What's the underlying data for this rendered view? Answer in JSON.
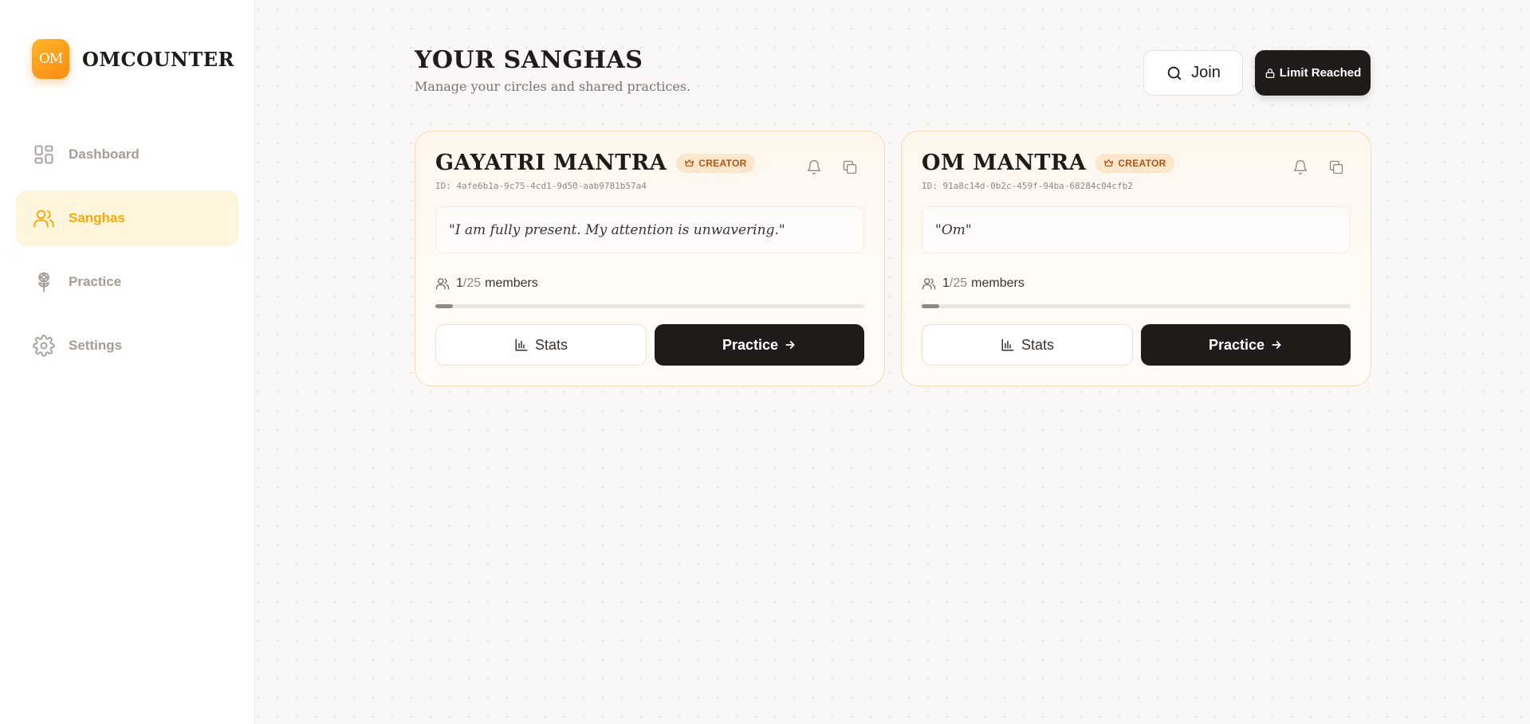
{
  "app": {
    "logo_text": "OM",
    "name": "OMCOUNTER"
  },
  "sidebar": {
    "items": [
      {
        "label": "Dashboard",
        "icon": "dashboard-icon",
        "active": false
      },
      {
        "label": "Sanghas",
        "icon": "users-icon",
        "active": true
      },
      {
        "label": "Practice",
        "icon": "flower-icon",
        "active": false
      },
      {
        "label": "Settings",
        "icon": "gear-icon",
        "active": false
      }
    ]
  },
  "header": {
    "title": "YOUR SANGHAS",
    "subtitle": "Manage your circles and shared practices.",
    "join_label": "Join",
    "limit_label": "Limit Reached"
  },
  "cards": [
    {
      "title": "GAYATRI MANTRA",
      "badge": "CREATOR",
      "id": "ID: 4afe6b1a-9c75-4cd1-9d50-aab9781b57a4",
      "quote": "\"I am fully present. My attention is unwavering.\"",
      "members_count": "1",
      "members_total": "/25",
      "members_label": "members",
      "progress": 0.04,
      "stats_label": "Stats",
      "practice_label": "Practice"
    },
    {
      "title": "OM MANTRA",
      "badge": "CREATOR",
      "id": "ID: 91a8c14d-0b2c-459f-94ba-68284c04cfb2",
      "quote": "\"Om\"",
      "members_count": "1",
      "members_total": "/25",
      "members_label": "members",
      "progress": 0.04,
      "stats_label": "Stats",
      "practice_label": "Practice"
    }
  ],
  "colors": {
    "accent": "#f5a911",
    "dark": "#1f1b18",
    "badge_text": "#b35312",
    "badge_bg": "#fde7cc"
  }
}
